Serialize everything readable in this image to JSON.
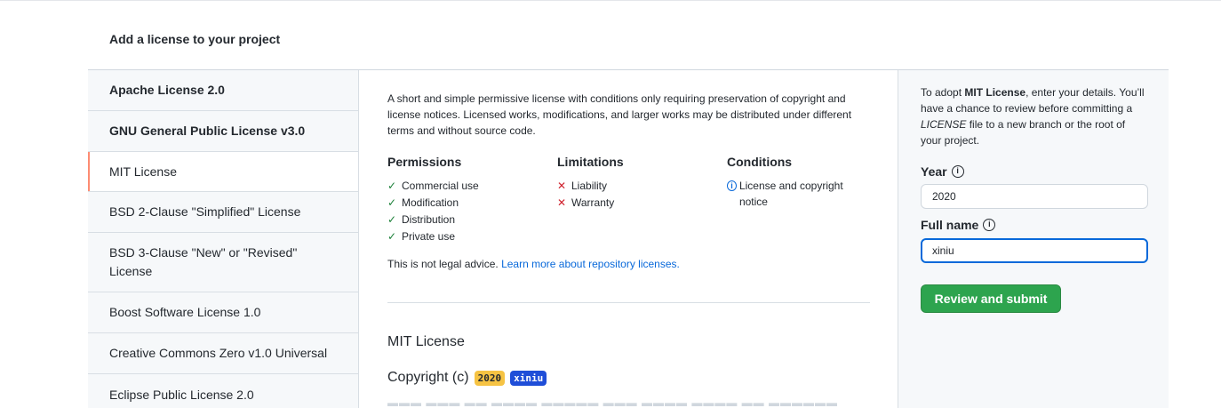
{
  "page_title": "Add a license to your project",
  "sidebar": {
    "items": [
      {
        "label": "Apache License 2.0"
      },
      {
        "label": "GNU General Public License v3.0"
      },
      {
        "label": "MIT License"
      },
      {
        "label": "BSD 2-Clause \"Simplified\" License"
      },
      {
        "label": "BSD 3-Clause \"New\" or \"Revised\" License"
      },
      {
        "label": "Boost Software License 1.0"
      },
      {
        "label": "Creative Commons Zero v1.0 Universal"
      },
      {
        "label": "Eclipse Public License 2.0"
      }
    ],
    "selected": "MIT License"
  },
  "main": {
    "description": "A short and simple permissive license with conditions only requiring preservation of copyright and license notices. Licensed works, modifications, and larger works may be distributed under different terms and without source code.",
    "permissions": {
      "heading": "Permissions",
      "items": [
        "Commercial use",
        "Modification",
        "Distribution",
        "Private use"
      ]
    },
    "limitations": {
      "heading": "Limitations",
      "items": [
        "Liability",
        "Warranty"
      ]
    },
    "conditions": {
      "heading": "Conditions",
      "items": [
        "License and copyright notice"
      ]
    },
    "legal_text": "This is not legal advice.",
    "legal_link": "Learn more about repository licenses.",
    "license_title": "MIT License",
    "copyright_prefix": "Copyright (c)",
    "year_tag": "2020",
    "name_tag": "xiniu"
  },
  "form": {
    "adopt_prefix": "To adopt",
    "adopt_license": "MIT License",
    "adopt_mid": ", enter your details. You’ll have a chance to review before committing a",
    "adopt_file": "LICENSE",
    "adopt_suffix": "file to a new branch or the root of your project.",
    "year_label": "Year",
    "year_value": "2020",
    "fullname_label": "Full name",
    "fullname_value": "xiniu",
    "submit_label": "Review and submit"
  },
  "colors": {
    "accent_blue": "#0969da",
    "submit_green": "#2da44e",
    "selected_marker": "#fd8c73",
    "year_tag_bg": "#f6c343",
    "name_tag_bg": "#1f4ed8"
  },
  "icons": {
    "permission": "check-icon",
    "limitation": "x-icon",
    "condition": "info-icon",
    "field_help": "question-icon"
  }
}
